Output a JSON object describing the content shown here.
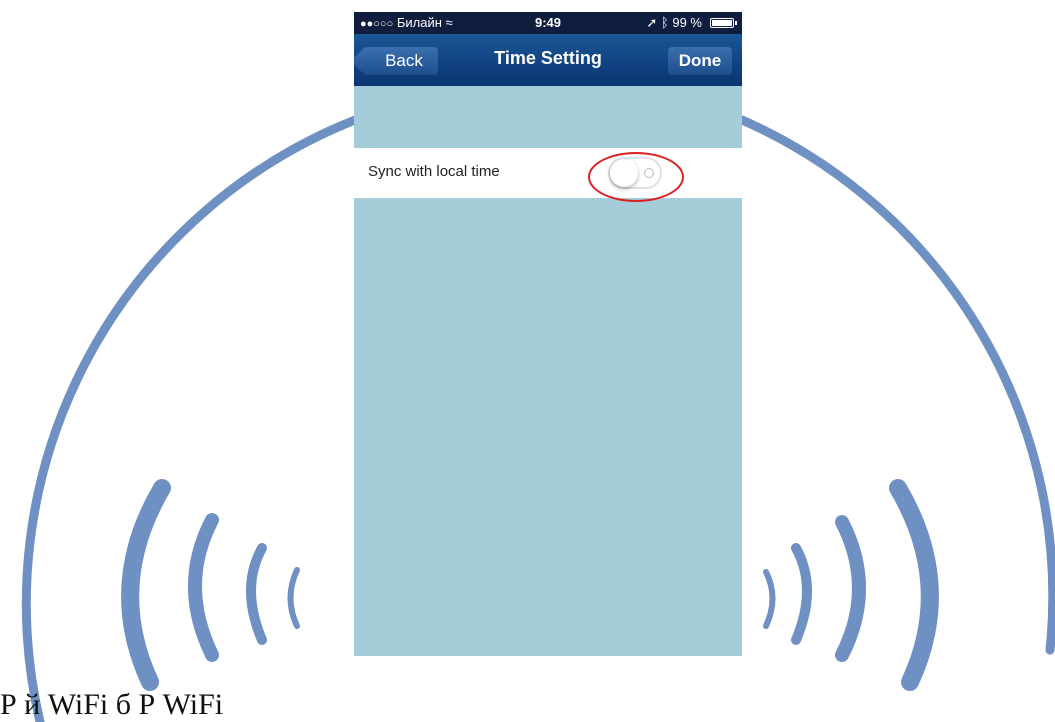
{
  "status_bar": {
    "signal_dots": "●●○○○",
    "carrier": "Билайн",
    "time": "9:49",
    "battery": "99 %",
    "battery_level": 0.99
  },
  "nav_bar": {
    "back_label": "Back",
    "title": "Time Setting",
    "done_label": "Done"
  },
  "settings": {
    "sync_label": "Sync with local time",
    "sync_enabled": false
  },
  "caption": "Р             й     WiFi        б            Р                 WiFi",
  "colors": {
    "nav": "#0a3572",
    "background": "#a4ccd9",
    "watermark": "#6f90c2",
    "annotation": "#e02020"
  }
}
